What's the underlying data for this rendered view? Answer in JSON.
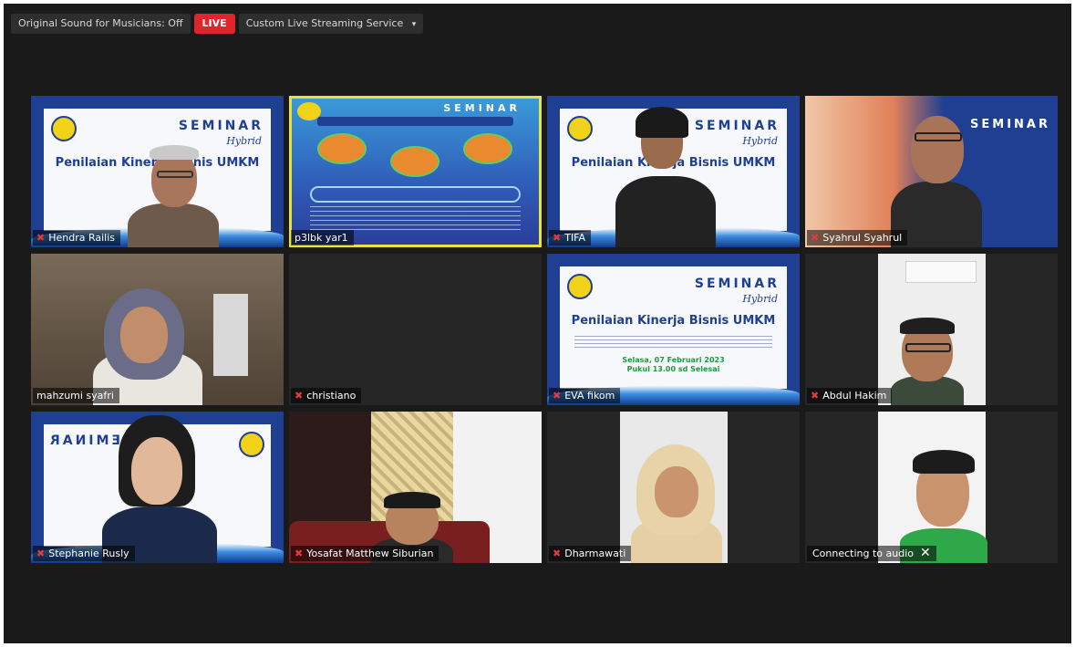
{
  "toolbar": {
    "original_sound": "Original Sound for Musicians: Off",
    "live_badge": "LIVE",
    "streaming_service": "Custom Live Streaming Service",
    "dropdown_glyph": "▾"
  },
  "participants": [
    {
      "name": "Hendra Railis",
      "muted": true
    },
    {
      "name": "p3lbk yar1",
      "muted": false,
      "active_speaker": true
    },
    {
      "name": "TIFA",
      "muted": true
    },
    {
      "name": "Syahrul Syahrul",
      "muted": true
    },
    {
      "name": "mahzumi syafri",
      "muted": false
    },
    {
      "name": "christiano",
      "muted": true
    },
    {
      "name": "EVA fikom",
      "muted": true
    },
    {
      "name": "Abdul Hakim",
      "muted": true
    },
    {
      "name": "Stephanie Rusly",
      "muted": true
    },
    {
      "name": "Yosafat Matthew Siburian",
      "muted": true
    },
    {
      "name": "Dharmawati",
      "muted": true
    },
    {
      "name": "Connecting to audio",
      "muted": false
    }
  ],
  "slide": {
    "seminar": "SEMINAR",
    "hybrid": "Hybrid",
    "title": "Penilaian Kinerja Bisnis UMKM",
    "date_line1": "Selasa, 07 Februari 2023",
    "date_line2": "Pukul 13.00 sd Selesai"
  },
  "colors": {
    "background": "#1a1a1a",
    "live": "#e0242c",
    "active_border": "#e8e43a",
    "muted_icon": "#e8383d",
    "slide_blue": "#1f3f92"
  },
  "icons": {
    "muted": "mic-muted-icon",
    "close": "close-icon",
    "dropdown": "chevron-down-icon"
  }
}
